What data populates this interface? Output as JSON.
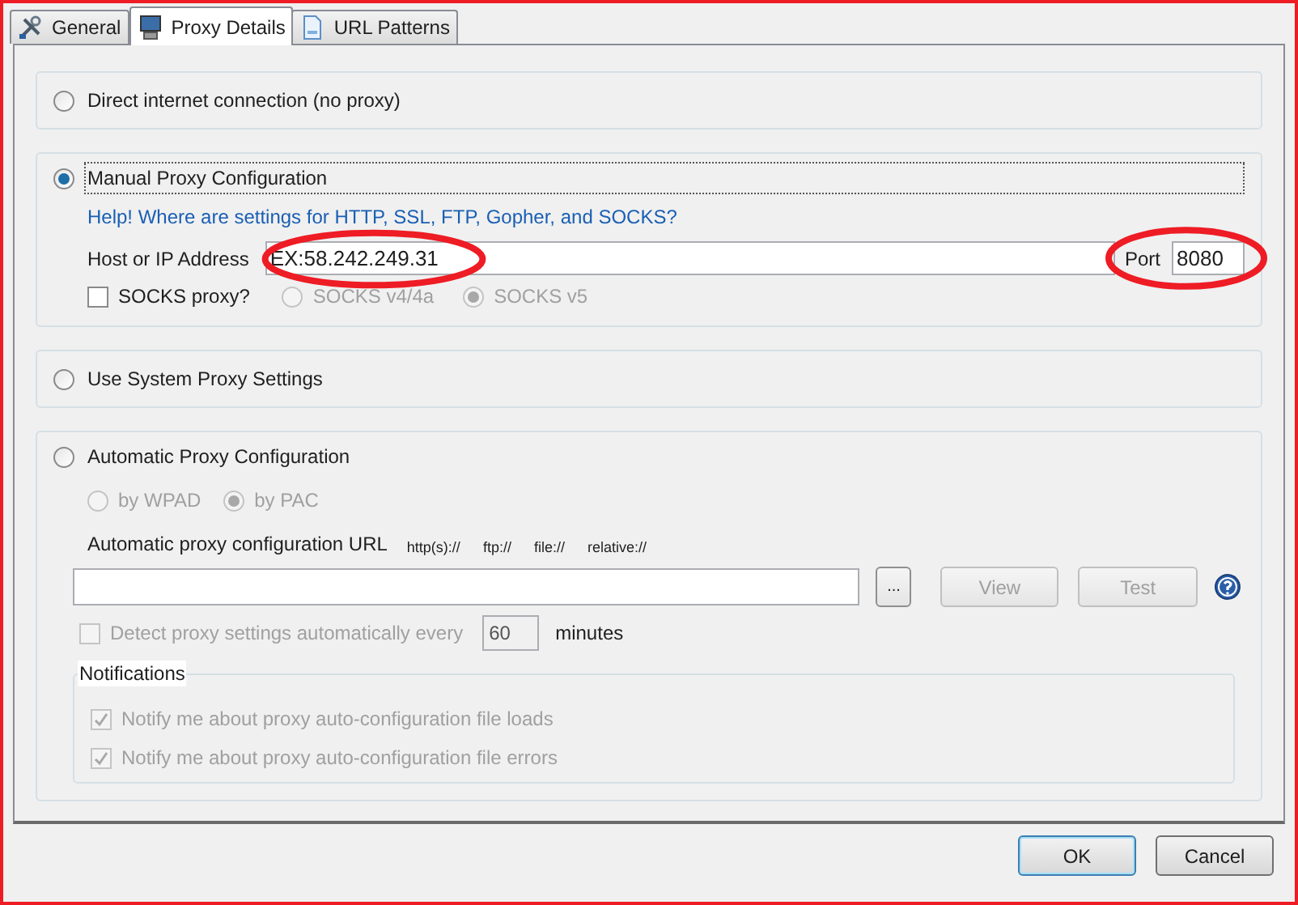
{
  "tabs": [
    {
      "label": "General",
      "selected": false
    },
    {
      "label": "Proxy Details",
      "selected": true
    },
    {
      "label": "URL Patterns",
      "selected": false
    }
  ],
  "modes": [
    {
      "kind": "direct",
      "label": "Direct internet connection (no proxy)",
      "selected": false
    },
    {
      "kind": "manual",
      "label": "Manual Proxy Configuration",
      "selected": true,
      "focused": true,
      "help_link": "Help! Where are settings for HTTP, SSL, FTP, Gopher, and SOCKS?",
      "host": {
        "label": "Host or IP Address",
        "value": "EX:58.242.249.31",
        "annotated": true
      },
      "port": {
        "label": "Port",
        "value": "8080",
        "annotated": true
      },
      "socks": {
        "label": "SOCKS proxy?",
        "checked": false
      },
      "socks_versions": [
        {
          "label": "SOCKS v4/4a",
          "selected": false,
          "disabled": true
        },
        {
          "label": "SOCKS v5",
          "selected": true,
          "disabled": true
        }
      ]
    },
    {
      "kind": "system",
      "label": "Use System Proxy Settings",
      "selected": false
    },
    {
      "kind": "automatic",
      "label": "Automatic Proxy Configuration",
      "selected": false,
      "methods": [
        {
          "label": "by WPAD",
          "selected": false,
          "disabled": true
        },
        {
          "label": "by PAC",
          "selected": true,
          "disabled": true
        }
      ],
      "url_label": "Automatic proxy configuration URL",
      "schemes": [
        "http(s)://",
        "ftp://",
        "file://",
        "relative://"
      ],
      "browse_button": {
        "label": "...",
        "disabled": false
      },
      "view_button": {
        "label": "View",
        "disabled": true
      },
      "test_button": {
        "label": "Test",
        "disabled": true
      },
      "detect": {
        "label": "Detect proxy settings automatically every",
        "checked": false,
        "disabled": true
      },
      "interval": "60",
      "interval_unit": "minutes",
      "notifications": {
        "title": "Notifications",
        "items": [
          {
            "label": "Notify me about proxy auto-configuration file loads",
            "checked": true,
            "disabled": true
          },
          {
            "label": "Notify me about proxy auto-configuration file errors",
            "checked": true,
            "disabled": true
          }
        ]
      }
    }
  ],
  "buttons": [
    {
      "label": "OK",
      "default": true
    },
    {
      "label": "Cancel",
      "default": false
    }
  ]
}
